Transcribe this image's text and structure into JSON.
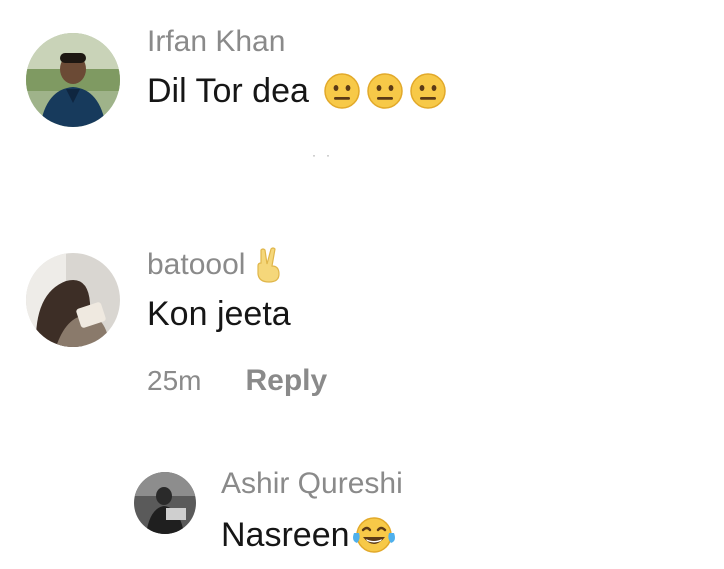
{
  "comments": [
    {
      "username": "Irfan Khan",
      "text": "Dil Tor dea",
      "emojis": [
        "neutral-face",
        "neutral-face",
        "neutral-face"
      ]
    },
    {
      "username": "batoool",
      "username_emoji": "victory-hand",
      "text": "Kon jeeta",
      "timestamp": "25m",
      "reply_label": "Reply",
      "replies": [
        {
          "username": "Ashir Qureshi",
          "text": "Nasreen",
          "emoji": "face-with-tears-of-joy"
        }
      ]
    }
  ],
  "colors": {
    "username": "#8a8a8a",
    "text": "#161616",
    "emoji_face": "#f7c948",
    "background": "#ffffff"
  }
}
